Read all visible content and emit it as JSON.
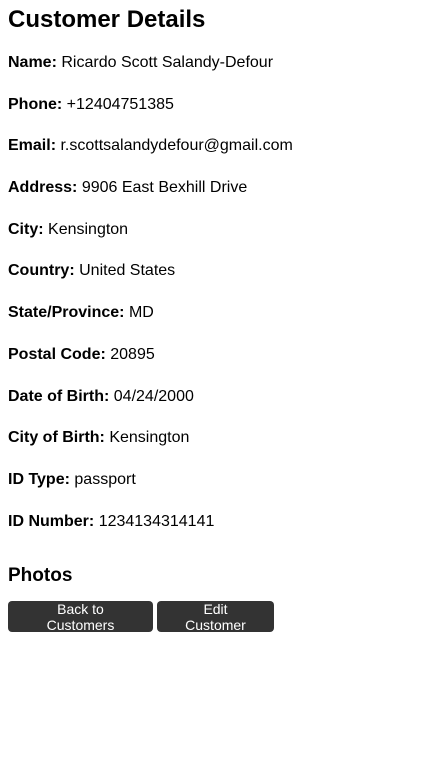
{
  "page_title": "Customer Details",
  "fields": [
    {
      "label": "Name:",
      "value": "Ricardo Scott Salandy-Defour"
    },
    {
      "label": "Phone:",
      "value": "+12404751385"
    },
    {
      "label": "Email:",
      "value": "r.scottsalandydefour@gmail.com"
    },
    {
      "label": "Address:",
      "value": "9906 East Bexhill Drive"
    },
    {
      "label": "City:",
      "value": "Kensington"
    },
    {
      "label": "Country:",
      "value": "United States"
    },
    {
      "label": "State/Province:",
      "value": "MD"
    },
    {
      "label": "Postal Code:",
      "value": "20895"
    },
    {
      "label": "Date of Birth:",
      "value": "04/24/2000"
    },
    {
      "label": "City of Birth:",
      "value": "Kensington"
    },
    {
      "label": "ID Type:",
      "value": "passport"
    },
    {
      "label": "ID Number:",
      "value": "1234134314141"
    }
  ],
  "photos_heading": "Photos",
  "actions": {
    "back_label": "Back to Customers",
    "edit_label": "Edit Customer"
  },
  "colors": {
    "button_bg": "#333333",
    "button_text": "#ffffff"
  }
}
